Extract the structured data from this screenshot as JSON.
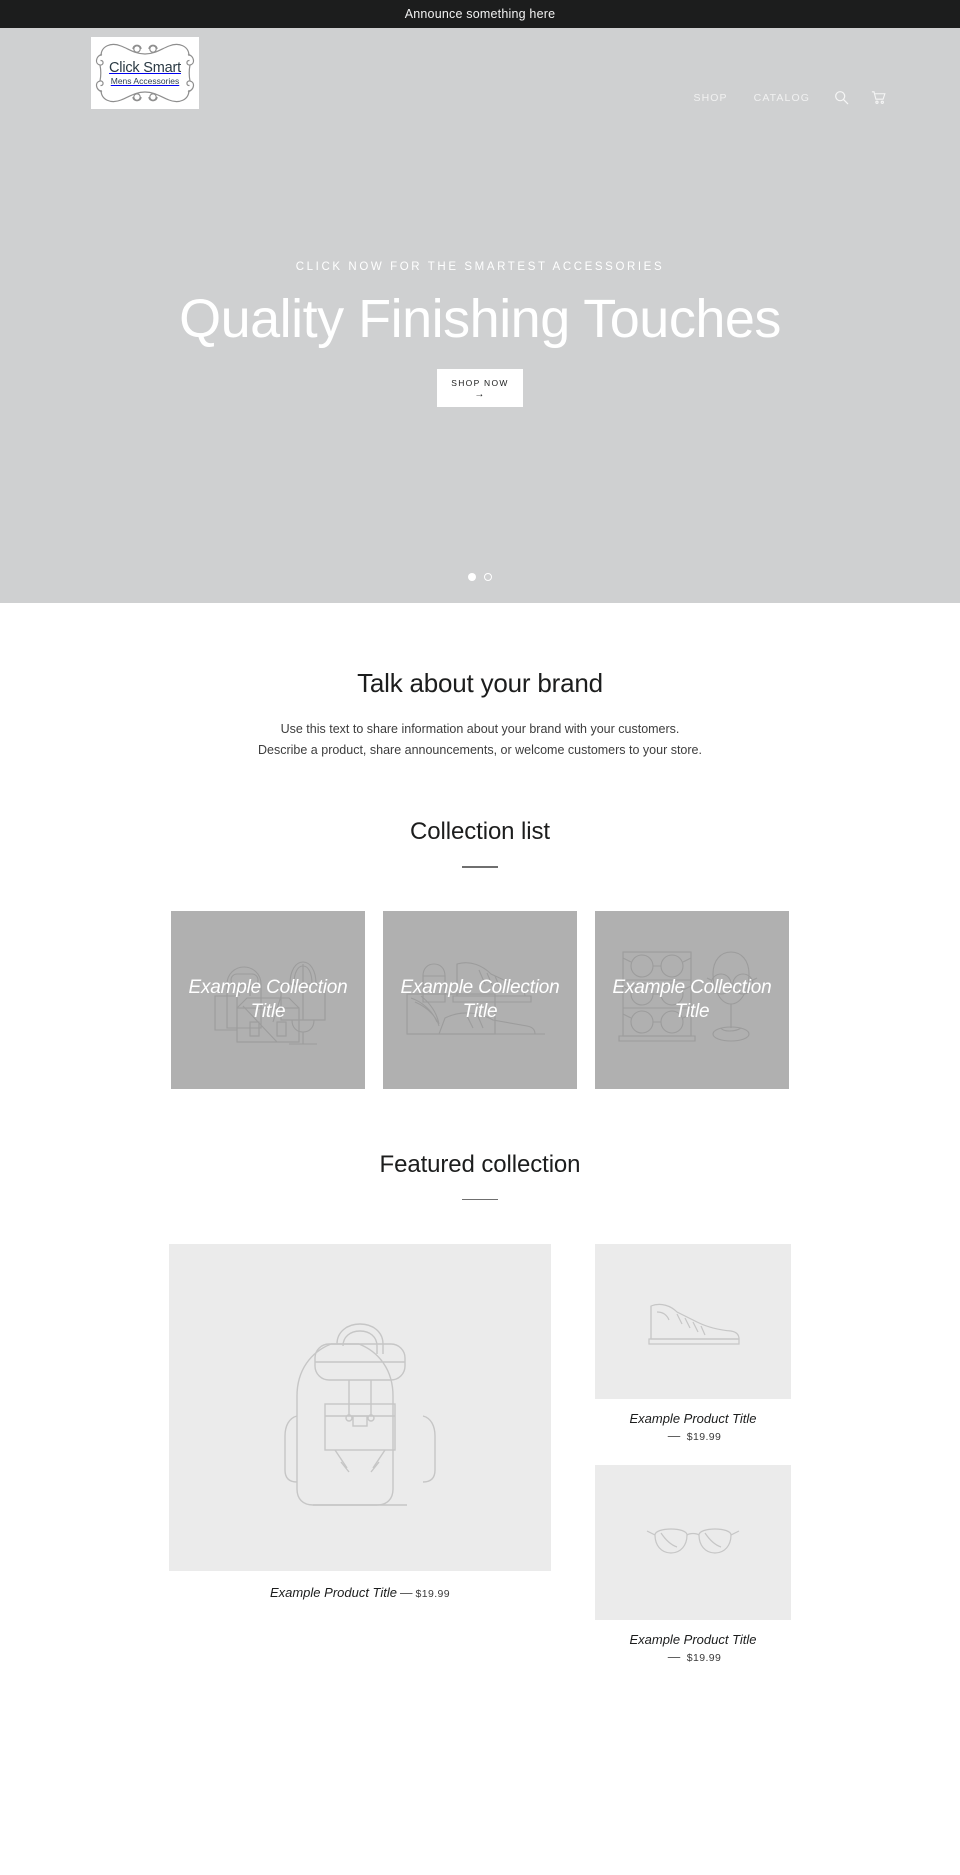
{
  "announcement": {
    "text": "Announce something here"
  },
  "header": {
    "logo": {
      "name": "Click Smart",
      "tagline": "Mens Accessories"
    },
    "nav": [
      {
        "label": "SHOP",
        "name": "nav-link-shop"
      },
      {
        "label": "CATALOG",
        "name": "nav-link-catalog"
      }
    ],
    "icons": {
      "search": "search-icon",
      "cart": "cart-icon"
    }
  },
  "hero": {
    "kicker": "CLICK NOW FOR THE SMARTEST ACCESSORIES",
    "title": "Quality Finishing Touches",
    "button_label": "SHOP NOW",
    "button_arrow": "→",
    "slides": [
      {
        "active": true
      },
      {
        "active": false
      }
    ]
  },
  "richtext": {
    "title": "Talk about your brand",
    "line1": "Use this text to share information about your brand with your customers.",
    "line2": "Describe a product, share announcements, or welcome customers to your store."
  },
  "collection_list": {
    "title": "Collection list",
    "items": [
      {
        "title": "Example Collection Title",
        "art": "bags-illustration"
      },
      {
        "title": "Example Collection Title",
        "art": "shoes-illustration"
      },
      {
        "title": "Example Collection Title",
        "art": "eyewear-illustration"
      }
    ]
  },
  "featured_collection": {
    "title": "Featured collection",
    "products": [
      {
        "title": "Example Product Title",
        "dash": "—",
        "price": "$19.99",
        "art": "backpack-illustration",
        "size": "large"
      },
      {
        "title": "Example Product Title",
        "dash": "—",
        "price": "$19.99",
        "art": "sneaker-illustration",
        "size": "small"
      },
      {
        "title": "Example Product Title",
        "dash": "—",
        "price": "$19.99",
        "art": "glasses-illustration",
        "size": "small"
      }
    ]
  },
  "colors": {
    "announce_bg": "#1c1d1d",
    "hero_bg": "#cfd0d1",
    "card_bg": "#b0b0b0",
    "product_bg": "#ebebeb",
    "text": "#1c1d1d",
    "logo_text": "#2b3a44"
  }
}
